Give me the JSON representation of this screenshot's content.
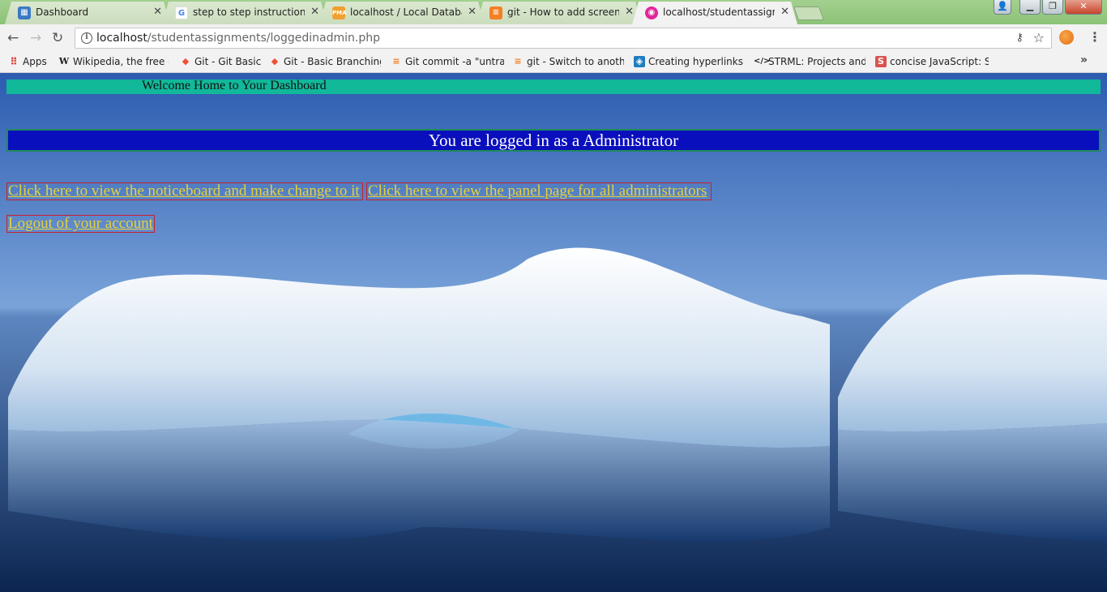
{
  "browser": {
    "tabs": [
      {
        "title": "Dashboard",
        "icon": "dashboard-favicon",
        "active": false
      },
      {
        "title": "step to step instructions",
        "icon": "google-favicon",
        "active": false
      },
      {
        "title": "localhost / Local Databas",
        "icon": "phpmyadmin-favicon",
        "active": false
      },
      {
        "title": "git - How to add screens",
        "icon": "stackoverflow-favicon",
        "active": false
      },
      {
        "title": "localhost/studentassignm",
        "icon": "site-favicon",
        "active": true
      }
    ],
    "address": {
      "host": "localhost",
      "path": "/studentassignments/loggedinadmin.php"
    },
    "bookmarks": [
      {
        "label": "Apps",
        "icon": "apps-grid-icon"
      },
      {
        "label": "Wikipedia, the free en",
        "icon": "wikipedia-icon"
      },
      {
        "label": "Git - Git Basics",
        "icon": "git-icon"
      },
      {
        "label": "Git - Basic Branching a",
        "icon": "git-icon"
      },
      {
        "label": "Git commit -a \"untrac",
        "icon": "stackoverflow-icon"
      },
      {
        "label": "git - Switch to anothe",
        "icon": "stackoverflow-icon"
      },
      {
        "label": "Creating hyperlinks - I",
        "icon": "mdn-icon"
      },
      {
        "label": "STRML: Projects and V",
        "icon": "code-icon"
      },
      {
        "label": "concise JavaScript: Sli",
        "icon": "slides-icon"
      }
    ],
    "more_bookmarks": "»"
  },
  "page": {
    "welcome": "Welcome Home to Your Dashboard",
    "role_banner": "You are logged in as a Administrator",
    "links": {
      "noticeboard": "Click here to view the noticeboard and make change to it",
      "panel": "Click here to view the panel page for all administrators",
      "logout": "Logout of your account"
    }
  },
  "colors": {
    "welcome_bar": "#11b89a",
    "role_banner": "#0a0fbd",
    "link_text": "#e6d23a",
    "link_border": "#c8202a"
  }
}
